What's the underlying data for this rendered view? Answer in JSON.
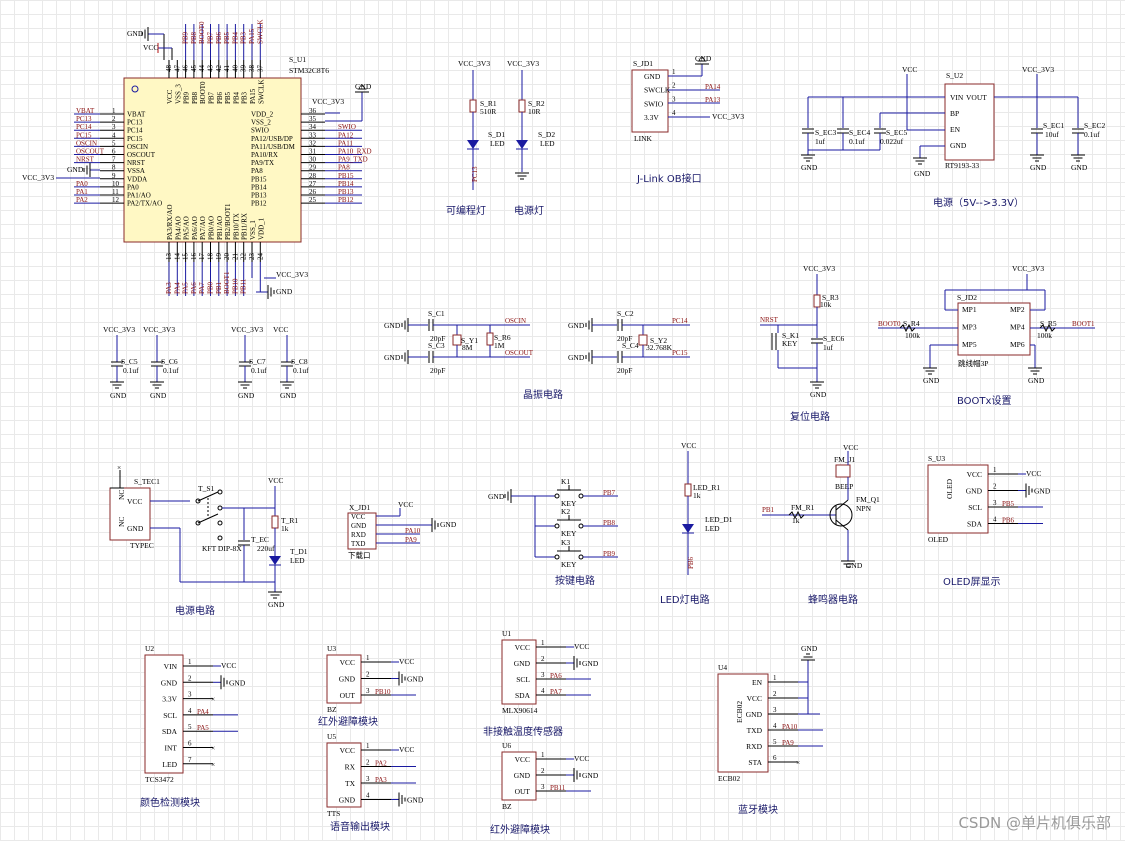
{
  "watermark": "CSDN @单片机俱乐部",
  "sections": {
    "prog_led": "可编程灯",
    "power_led": "电源灯",
    "jlink": "J-Link OB接口",
    "power": "电源（5V-->3.3V）",
    "crystal": "晶振电路",
    "reset": "复位电路",
    "boot": "BOOTx设置",
    "power_circuit": "电源电路",
    "keys": "按键电路",
    "led": "LED灯电路",
    "buzzer": "蜂鸣器电路",
    "oled": "OLED屏显示",
    "color": "颜色检测模块",
    "ir1": "红外避障模块",
    "temp": "非接触温度传感器",
    "bt": "蓝牙模块",
    "voice": "语音输出模块",
    "ir2": "红外避障模块"
  },
  "mcu": {
    "ref": "S_U1",
    "part": "STM32C8T6",
    "left_pins": [
      {
        "num": "1",
        "name": "VBAT",
        "net": "VBAT"
      },
      {
        "num": "2",
        "name": "PC13",
        "net": "PC13"
      },
      {
        "num": "3",
        "name": "PC14",
        "net": "PC14"
      },
      {
        "num": "4",
        "name": "PC15",
        "net": "PC15"
      },
      {
        "num": "5",
        "name": "OSCIN",
        "net": "OSCIN"
      },
      {
        "num": "6",
        "name": "OSCOUT",
        "net": "OSCOUT"
      },
      {
        "num": "7",
        "name": "NRST",
        "net": "NRST"
      },
      {
        "num": "8",
        "name": "VSSA",
        "net": "GND"
      },
      {
        "num": "9",
        "name": "VDDA",
        "net": "VCC_3V3"
      },
      {
        "num": "10",
        "name": "PA0",
        "net": "PA0"
      },
      {
        "num": "11",
        "name": "PA1/AO",
        "net": "PA1"
      },
      {
        "num": "12",
        "name": "PA2/TX/AO",
        "net": "PA2"
      }
    ],
    "right_pins": [
      {
        "num": "36",
        "name": "VDD_2",
        "net": "VCC_3V3"
      },
      {
        "num": "35",
        "name": "VSS_2",
        "net": "GND"
      },
      {
        "num": "34",
        "name": "SWIO",
        "net": "SWIO"
      },
      {
        "num": "33",
        "name": "PA12/USB/DP",
        "net": "PA12"
      },
      {
        "num": "32",
        "name": "PA11/USB/DM",
        "net": "PA11"
      },
      {
        "num": "31",
        "name": "PA10/RX",
        "net": "PA10_RXD"
      },
      {
        "num": "30",
        "name": "PA9/TX",
        "net": "PA9_TXD"
      },
      {
        "num": "29",
        "name": "PA8",
        "net": "PA8"
      },
      {
        "num": "28",
        "name": "PB15",
        "net": "PB15"
      },
      {
        "num": "27",
        "name": "PB14",
        "net": "PB14"
      },
      {
        "num": "26",
        "name": "PB13",
        "net": "PB13"
      },
      {
        "num": "25",
        "name": "PB12",
        "net": "PB12"
      }
    ],
    "top_pins": [
      {
        "num": "48",
        "name": "VCC"
      },
      {
        "num": "47",
        "name": "VSS_3"
      },
      {
        "num": "46",
        "name": "PB9"
      },
      {
        "num": "45",
        "name": "PB8"
      },
      {
        "num": "44",
        "name": "BOOT0"
      },
      {
        "num": "43",
        "name": "PB7"
      },
      {
        "num": "42",
        "name": "PB6"
      },
      {
        "num": "41",
        "name": "PB5"
      },
      {
        "num": "40",
        "name": "PB4"
      },
      {
        "num": "39",
        "name": "PB3"
      },
      {
        "num": "38",
        "name": "PA15"
      },
      {
        "num": "37",
        "name": "SWCLK"
      }
    ],
    "top_nets": [
      "VCC",
      "GND",
      "PB9",
      "PB8",
      "BOOT0",
      "PB7",
      "PB6",
      "PB5",
      "PB4",
      "PB3",
      "PA15",
      "SWCLK"
    ],
    "bottom_pins": [
      {
        "num": "13",
        "name": "PA3/RX/AO"
      },
      {
        "num": "14",
        "name": "PA4/AO"
      },
      {
        "num": "15",
        "name": "PA5/AO"
      },
      {
        "num": "16",
        "name": "PA6/AO"
      },
      {
        "num": "17",
        "name": "PA7/AO"
      },
      {
        "num": "18",
        "name": "PB0/AO"
      },
      {
        "num": "19",
        "name": "PB1/AO"
      },
      {
        "num": "20",
        "name": "PB2/BOOT1"
      },
      {
        "num": "21",
        "name": "PB10/TX"
      },
      {
        "num": "22",
        "name": "PB11/RX"
      },
      {
        "num": "23",
        "name": "VSS_1"
      },
      {
        "num": "24",
        "name": "VDD_1"
      }
    ],
    "bottom_nets": [
      "PA3",
      "PA4",
      "PA5",
      "PA6",
      "PA7",
      "PB0",
      "PB1",
      "BOOT1",
      "PB10",
      "PB11"
    ]
  },
  "labels": {
    "gnd": "GND",
    "vcc": "VCC",
    "vcc33": "VCC_3V3",
    "r1": "S_R1",
    "r1v": "510R",
    "r2": "S_R2",
    "r2v": "10R",
    "d1": "S_D1",
    "d2": "S_D2",
    "led": "LED",
    "pc13": "PC13",
    "jd1": "S_JD1",
    "link": "LINK",
    "jpins": [
      "GND",
      "SWCLK",
      "SWIO",
      "3.3V"
    ],
    "pa14": "PA14",
    "pa13": "PA13",
    "u2": "S_U2",
    "rt": "RT9193-33",
    "u2l": [
      "VIN",
      "BP",
      "EN",
      "GND"
    ],
    "u2r": "VOUT",
    "ec3": "S_EC3",
    "ec4": "S_EC4",
    "ec5": "S_EC5",
    "ec1": "S_EC1",
    "ec2": "S_EC2",
    "v1uf": "1uf",
    "v01uf": "0.1uf",
    "v022": "0.022uf",
    "v10uf": "10uf",
    "c5": "S_C5",
    "c6": "S_C6",
    "c7": "S_C7",
    "c8": "S_C8",
    "c1": "S_C1",
    "c2": "S_C2",
    "c3": "S_C3",
    "c4": "S_C4",
    "v20pf": "20pF",
    "y1": "S_Y1",
    "y1v": "8M",
    "y2": "S_Y2",
    "y2v": "32.768K",
    "r6": "S_R6",
    "r6v": "1M",
    "oscin": "OSCIN",
    "oscout": "OSCOUT",
    "pc14": "PC14",
    "pc15": "PC15",
    "r3": "S_R3",
    "r10k": "10k",
    "nrst": "NRST",
    "k1": "S_K1",
    "key": "KEY",
    "ec6": "S_EC6",
    "jd2": "S_JD2",
    "mp": [
      "MP1",
      "MP2",
      "MP3",
      "MP4",
      "MP5",
      "MP6"
    ],
    "jump": "跳线帽3P",
    "boot0": "BOOT0",
    "boot1": "BOOT1",
    "r4": "S_R4",
    "r5": "S_R5",
    "r100k": "100k",
    "tec1": "S_TEC1",
    "nc": "NC",
    "typec": "TYPEC",
    "s1": "T_S1",
    "kft": "KFT DIP-8X",
    "ec": "T_EC",
    "v220": "220uf",
    "tr1": "T_R1",
    "v1k": "1k",
    "td1": "T_D1",
    "xjd1": "X_JD1",
    "dl": "下载口",
    "xpins": [
      "VCC",
      "GND",
      "RXD",
      "TXD"
    ],
    "pa10": "PA10",
    "pa9": "PA9",
    "k1s": "K1",
    "k2": "K2",
    "k3": "K3",
    "pb7": "PB7",
    "pb8": "PB8",
    "pb9": "PB9",
    "ledr1": "LED_R1",
    "ledd1": "LED_D1",
    "pb6": "PB6",
    "fmj1": "FM_J1",
    "beep": "BEEP",
    "fmq1": "FM_Q1",
    "npn": "NPN",
    "pb1": "PB1",
    "fmr1": "FM_R1",
    "su3": "S_U3",
    "oled": "OLED",
    "opins": [
      "VCC",
      "GND",
      "SCL",
      "SDA"
    ],
    "pb5": "PB5",
    "u2m": "U2",
    "tcs": "TCS3472",
    "cpins": [
      "VIN",
      "GND",
      "3.3V",
      "SCL",
      "SDA",
      "INT",
      "LED"
    ],
    "pa4": "PA4",
    "pa5": "PA5",
    "u3": "U3",
    "bz": "BZ",
    "irpins": [
      "VCC",
      "GND",
      "OUT"
    ],
    "pb10": "PB10",
    "u1": "U1",
    "mlx": "MLX90614",
    "mpins": [
      "VCC",
      "GND",
      "SCL",
      "SDA"
    ],
    "pa6": "PA6",
    "pa7": "PA7",
    "u4": "U4",
    "ecb": "ECB02",
    "bpins": [
      "EN",
      "VCC",
      "GND",
      "TXD",
      "RXD",
      "STA"
    ],
    "u5": "U5",
    "tts": "TTS",
    "vpins": [
      "VCC",
      "RX",
      "TX",
      "GND"
    ],
    "pa2": "PA2",
    "pa3": "PA3",
    "u6": "U6",
    "pb11": "PB11"
  }
}
